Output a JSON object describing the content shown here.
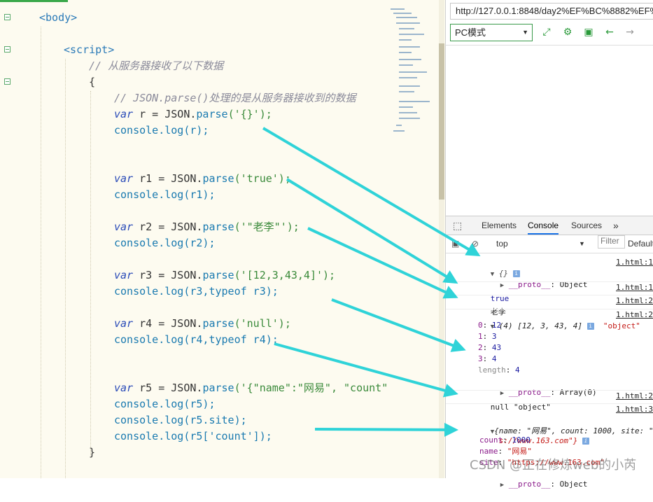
{
  "editor": {
    "lines": {
      "body_tag": "<body>",
      "script_tag": "<script>",
      "comment1": "// 从服务器接收了以下数据",
      "open_brace": "{",
      "comment2": "// JSON.parse()处理的是从服务器接收到的数据",
      "r_a": "var",
      "r_b": " r = JSON.",
      "r_c": "parse",
      "r_d": "('{}');",
      "log_r": "console.log(r);",
      "r1_a": "var",
      "r1_b": " r1 = JSON.",
      "r1_c": "parse",
      "r1_d": "('true');",
      "log_r1": "console.log(r1);",
      "r2_a": "var",
      "r2_b": " r2 = JSON.",
      "r2_c": "parse",
      "r2_d": "('\"老李\"');",
      "log_r2": "console.log(r2);",
      "r3_a": "var",
      "r3_b": " r3 = JSON.",
      "r3_c": "parse",
      "r3_d": "('[12,3,43,4]');",
      "log_r3": "console.log(r3,typeof r3);",
      "r4_a": "var",
      "r4_b": " r4 = JSON.",
      "r4_c": "parse",
      "r4_d": "('null');",
      "log_r4": "console.log(r4,typeof r4);",
      "r5_a": "var",
      "r5_b": " r5 = JSON.",
      "r5_c": "parse",
      "r5_d": "('{\"name\":\"网易\", \"count\"",
      "log_r5": "console.log(r5);",
      "log_r5_site": "console.log(r5.site);",
      "log_r5_count": "console.log(r5['count']);",
      "close_brace": "}"
    }
  },
  "browser": {
    "url": "http://127.0.0.1:8848/day2%EF%BC%8882%EF%BC",
    "mode": "PC模式",
    "icons": [
      "screenshot-icon",
      "settings-icon",
      "console-icon",
      "back-icon",
      "forward-icon"
    ]
  },
  "devtools": {
    "tabs": [
      "Elements",
      "Console",
      "Sources",
      "»"
    ],
    "active_tab": "Console",
    "context": "top",
    "filter_placeholder": "Filter",
    "levels": "Default",
    "logs": {
      "l1_obj": "{}",
      "l1_src": "1.html:1",
      "l1_proto": "__proto__",
      "l1_proto_val": ": Object",
      "l2_val": "true",
      "l2_src": "1.html:1",
      "l3_val": "老李",
      "l3_src": "1.html:2",
      "l4_head": "(4) [12, 3, 43, 4]",
      "l4_type": "\"object\"",
      "l4_src": "1.html:2",
      "l4_i0": "0",
      "l4_v0": "12",
      "l4_i1": "1",
      "l4_v1": "3",
      "l4_i2": "2",
      "l4_v2": "43",
      "l4_i3": "3",
      "l4_v3": "4",
      "l4_len": "length",
      "l4_lenv": "4",
      "l4_proto": "__proto__",
      "l4_proto_val": ": Array(0)",
      "l5_val": "null \"object\"",
      "l5_src": "1.html:2",
      "l6_src": "1.html:3",
      "l6_line1": "{name: \"网易\", count: 1000, site: \"http",
      "l6_line2": "s://www.163.com\"}",
      "l6_count_k": "count",
      "l6_count_v": "1000",
      "l6_name_k": "name",
      "l6_name_v": "\"网易\"",
      "l6_site_k": "site",
      "l6_site_v": "\"https://www.163.com\"",
      "l6_proto": "__proto__",
      "l6_proto_val": ": Object"
    }
  },
  "watermark": "CSDN @正在修炼web的小芮",
  "colors": {
    "arrow": "#2fd3d8",
    "accent": "#3aa84a",
    "editor_bg": "#fdfbf0"
  }
}
